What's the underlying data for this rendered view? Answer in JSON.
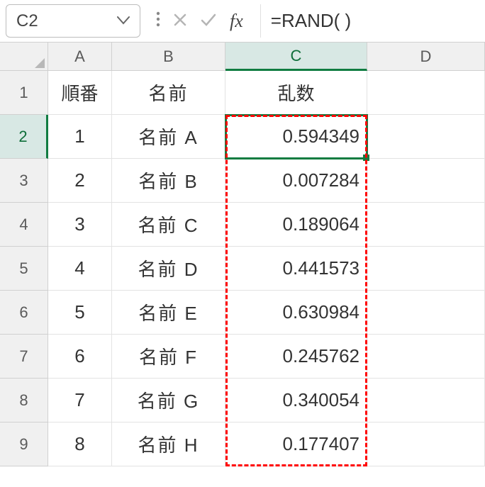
{
  "formula_bar": {
    "name_box": "C2",
    "formula": "=RAND( )"
  },
  "columns": [
    "A",
    "B",
    "C",
    "D"
  ],
  "row_numbers": [
    "1",
    "2",
    "3",
    "4",
    "5",
    "6",
    "7",
    "8",
    "9"
  ],
  "headers": {
    "A": "順番",
    "B": "名前",
    "C": "乱数"
  },
  "rows": [
    {
      "A": "1",
      "B": "名前 A",
      "C": "0.594349"
    },
    {
      "A": "2",
      "B": "名前 B",
      "C": "0.007284"
    },
    {
      "A": "3",
      "B": "名前 C",
      "C": "0.189064"
    },
    {
      "A": "4",
      "B": "名前 D",
      "C": "0.441573"
    },
    {
      "A": "5",
      "B": "名前 E",
      "C": "0.630984"
    },
    {
      "A": "6",
      "B": "名前 F",
      "C": "0.245762"
    },
    {
      "A": "7",
      "B": "名前 G",
      "C": "0.340054"
    },
    {
      "A": "8",
      "B": "名前 H",
      "C": "0.177407"
    }
  ],
  "active_cell": "C2",
  "highlight_range": "C2:C9",
  "colors": {
    "accent": "#107c41",
    "highlight_dash": "#ff0000",
    "header_bg": "#f0f0f0"
  }
}
